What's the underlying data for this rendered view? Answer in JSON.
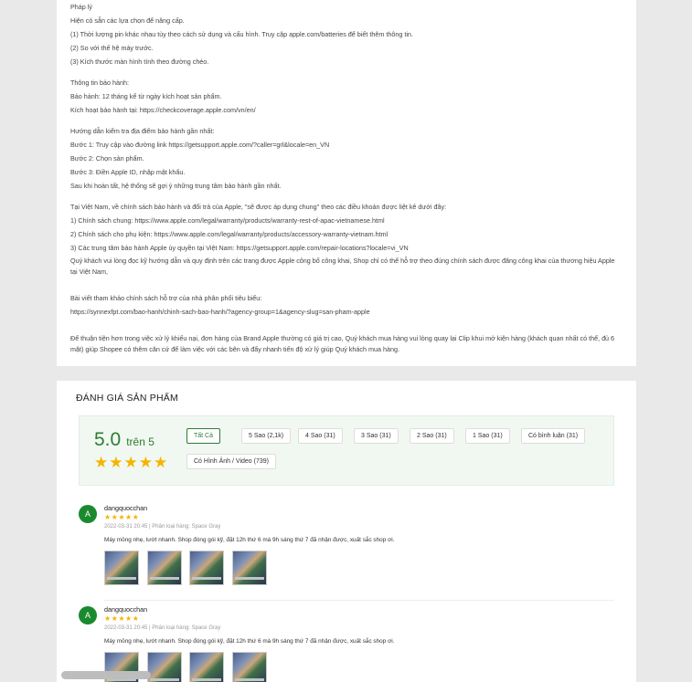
{
  "description": {
    "block1": [
      "Pháp lý",
      "Hiện có sẵn các lựa chọn để nâng cấp.",
      "(1) Thời lượng pin khác nhau tùy theo cách sử dụng và cấu hình. Truy cập apple.com/batteries để biết thêm thông tin.",
      "(2) So với thế hệ máy trước.",
      "(3) Kích thước màn hình tính theo đường chéo."
    ],
    "block2": [
      "Thông tin bảo hành:",
      "Bảo hành: 12 tháng kể từ ngày kích hoạt sản phẩm.",
      "Kích hoạt bảo hành tại: https://checkcoverage.apple.com/vn/en/"
    ],
    "block3": [
      "Hướng dẫn kiểm tra địa điểm bảo hành gần nhất:",
      "Bước 1: Truy cập vào đường link https://getsupport.apple.com/?caller=grl&locale=en_VN",
      "Bước 2: Chọn sản phẩm.",
      "Bước 3: Điền Apple ID, nhập mật khẩu.",
      "Sau khi hoàn tất, hệ thống sẽ gợi ý những trung tâm bảo hành gần nhất."
    ],
    "block4": [
      "Tại Việt Nam, về chính sách bảo hành và đổi trả của Apple, \"sẽ được áp dụng chung\" theo các điều khoản được liệt kê dưới đây:",
      "1) Chính sách chung: https://www.apple.com/legal/warranty/products/warranty-rest-of-apac-vietnamese.html",
      "2) Chính sách cho phụ kiện: https://www.apple.com/legal/warranty/products/accessory-warranty-vietnam.html",
      "3) Các trung tâm bảo hành Apple ủy quyền tại Việt Nam: https://getsupport.apple.com/repair-locations?locale=vi_VN"
    ],
    "block4_wrap": "Quý khách vui lòng đọc kỹ hướng dẫn và quy định trên các trang được Apple công bố công khai, Shop chỉ có thể hỗ trợ theo đúng chính sách được đăng công khai của thương hiệu Apple tại Việt Nam,",
    "block5": [
      "Bài viết tham khảo chính sách hỗ trợ của nhà phân phối tiêu biểu:",
      "https://synnexfpt.com/bao-hanh/chinh-sach-bao-hanh/?agency-group=1&agency-slug=san-pham-apple"
    ],
    "block6_wrap": " Để thuận tiện hơn trong việc xử lý khiếu nại, đơn hàng của Brand Apple thường có giá trị cao, Quý khách mua hàng vui lòng quay lại Clip khui mở kiện hàng (khách quan nhất có thể, đủ 6 mặt) giúp Shopee có thêm căn cứ để làm việc với các bên và đẩy nhanh tiến độ xử lý giúp Quý khách mua hàng."
  },
  "ratings": {
    "title": "ĐÁNH GIÁ SẢN PHẨM",
    "score": "5.0",
    "score_suffix": "trên 5",
    "stars": "★★★★★",
    "accent_color": "#2e7d32",
    "star_color": "#f5b400",
    "filters": [
      {
        "label": "Tất Cả",
        "active": true
      },
      {
        "label": "5 Sao (2,1k)",
        "active": false
      },
      {
        "label": "4 Sao (31)",
        "active": false
      },
      {
        "label": "3 Sao (31)",
        "active": false
      },
      {
        "label": "2 Sao (31)",
        "active": false
      },
      {
        "label": "1 Sao (31)",
        "active": false
      },
      {
        "label": "Có bình luận (31)",
        "active": false
      },
      {
        "label": "Có Hình Ảnh / Video (739)",
        "active": false
      }
    ]
  },
  "reviews": [
    {
      "avatar_letter": "A",
      "username": "dangquocchan",
      "stars": "★★★★★",
      "meta": "2022-03-31 20:45 | Phân loại hàng: Space Gray",
      "text": "Máy mỏng nhẹ, lướt nhanh. Shop đóng gói kỹ, đặt 12h thứ 6 mà 9h sáng thứ 7 đã nhận được, xuất sắc shop ơi."
    },
    {
      "avatar_letter": "A",
      "username": "dangquocchan",
      "stars": "★★★★★",
      "meta": "2022-03-31 20:45 | Phân loại hàng: Space Gray",
      "text": "Máy mỏng nhẹ, lướt nhanh. Shop đóng gói kỹ, đặt 12h thứ 6 mà 9h sáng thứ 7 đã nhận được, xuất sắc shop ơi."
    }
  ]
}
